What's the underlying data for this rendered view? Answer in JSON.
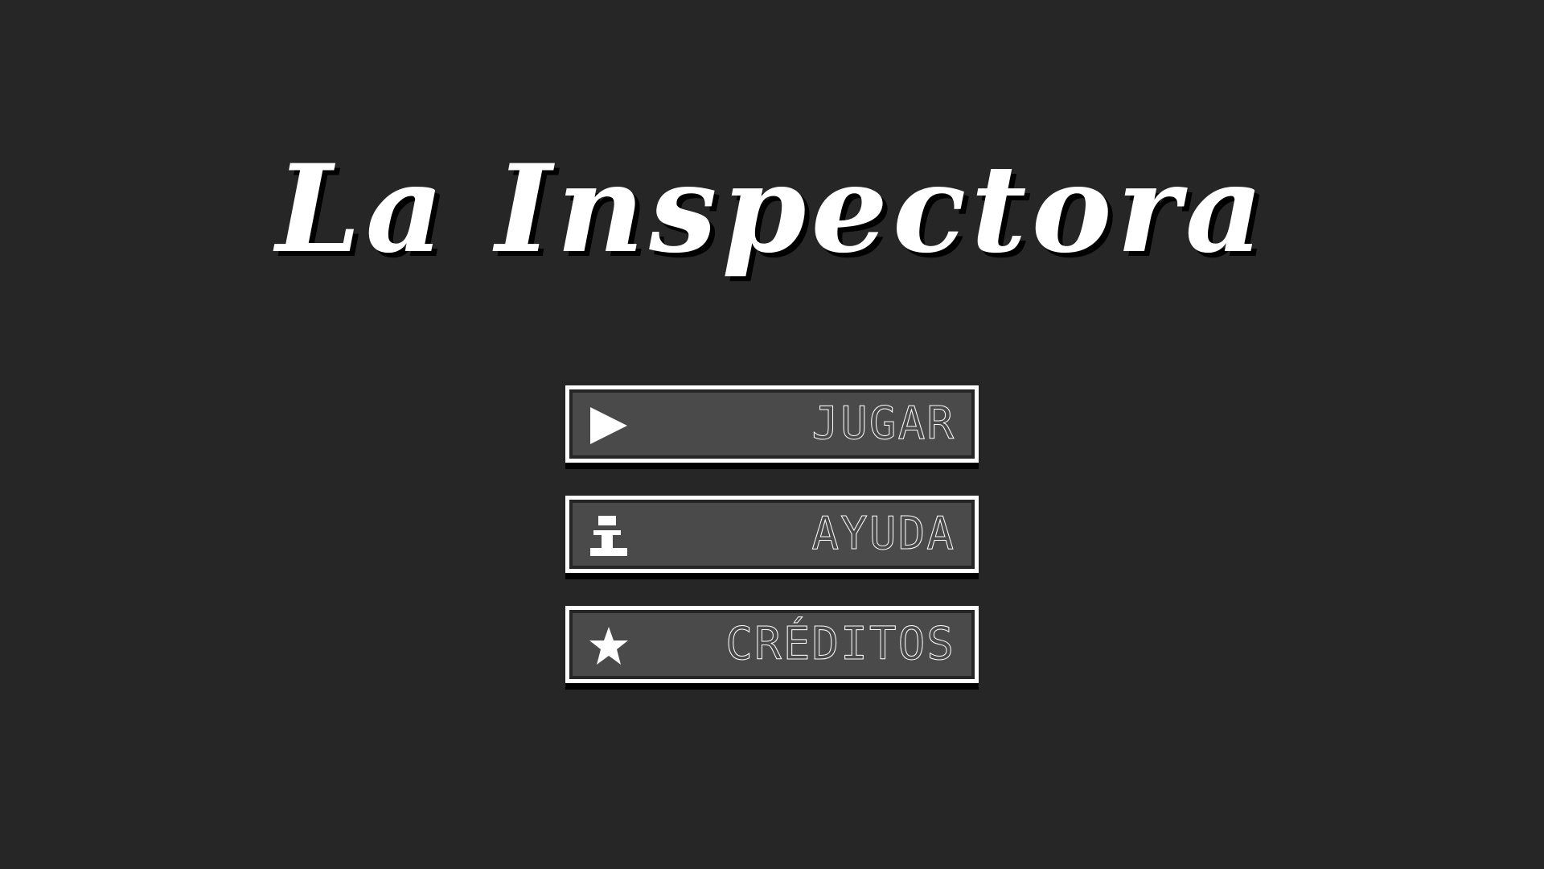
{
  "game": {
    "title": "La Inspectora"
  },
  "menu": {
    "items": [
      {
        "label": "JUGAR",
        "icon": "play-icon"
      },
      {
        "label": "AYUDA",
        "icon": "info-icon"
      },
      {
        "label": "CRÉDITOS",
        "icon": "star-icon"
      }
    ]
  },
  "colors": {
    "background": "#262626",
    "button_fill": "#4a4a4a",
    "button_border": "#ffffff",
    "text": "#ffffff",
    "shadow": "#000000"
  }
}
